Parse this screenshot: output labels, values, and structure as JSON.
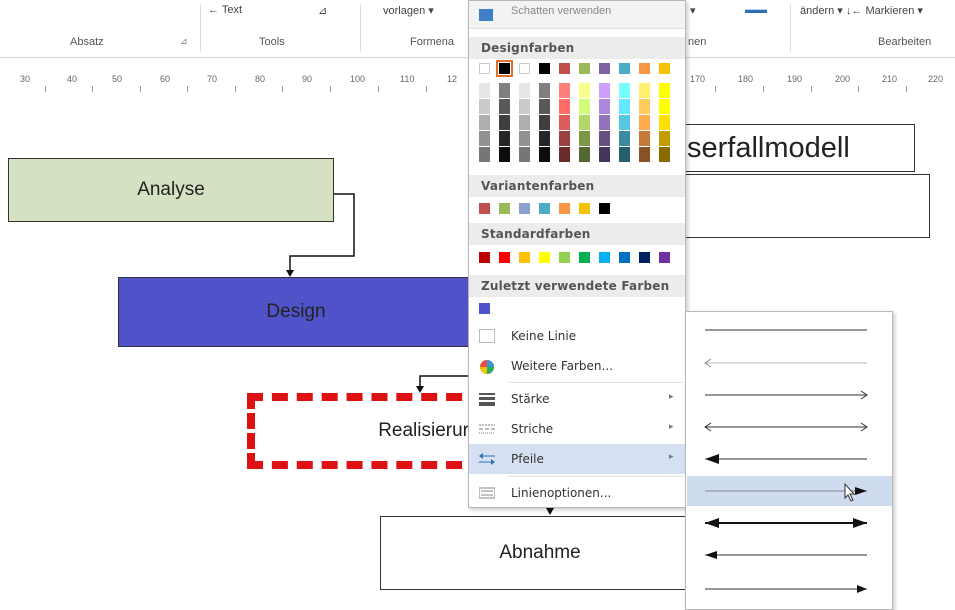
{
  "ribbon": {
    "frag_styles": "← Text",
    "frag_formvorlagen": "vorlagen ▾",
    "frag_schatten": "Schatten verwenden",
    "frag_verbinder": "▾",
    "frag_andern": "ändern ▾ ↓← Markieren ▾",
    "group_absatz": "Absatz",
    "group_tools": "Tools",
    "group_formen": "Formena",
    "group_formen2": "nen",
    "group_bearbeiten": "Bearbeiten"
  },
  "ruler": {
    "ticks": [
      "30",
      "40",
      "50",
      "60",
      "70",
      "80",
      "90",
      "100",
      "110",
      "12",
      "170",
      "180",
      "190",
      "200",
      "210",
      "220"
    ]
  },
  "canvas": {
    "analyse": "Analyse",
    "design": "Design",
    "realisierung": "Realisierur",
    "abnahme": "Abnahme",
    "title": "serfallmodell",
    "colors": {
      "analyse_fill": "#d4e2c3",
      "design_fill": "#4f52c9",
      "real_border": "#dd1111"
    }
  },
  "color_menu": {
    "top_label": "Schatten verwenden",
    "header_design": "Designfarben",
    "header_varianten": "Variantenfarben",
    "header_standard": "Standardfarben",
    "header_recent": "Zuletzt verwendete Farben",
    "design_colors": [
      "#ffffff",
      "#000000",
      "#ffffff",
      "#000000",
      "#c0504d",
      "#9bbb59",
      "#8064a2",
      "#4bacc6",
      "#f79646",
      "#f5c200"
    ],
    "variant_colors": [
      "#c0504d",
      "#9bbb59",
      "#8aa0d0",
      "#4bacc6",
      "#f79646",
      "#f5c200",
      "#000000"
    ],
    "standard_colors": [
      "#c00000",
      "#ff0000",
      "#ffc000",
      "#ffff00",
      "#92d050",
      "#00b050",
      "#00b0f0",
      "#0070c0",
      "#002060",
      "#7030a0"
    ],
    "recent_colors": [
      "#4f52c9"
    ],
    "item_keine_linie": "Keine Linie",
    "item_weitere_farben": "Weitere Farben...",
    "item_staerke": "Stärke",
    "item_striche": "Striche",
    "item_pfeile": "Pfeile",
    "item_linienoptionen": "Linienoptionen..."
  },
  "arrow_menu": {
    "options": [
      "none",
      "start-open",
      "end-open",
      "both-open",
      "start-filled",
      "end-filled-selected",
      "both-filled",
      "start-filled-long",
      "end-filled-small"
    ]
  }
}
